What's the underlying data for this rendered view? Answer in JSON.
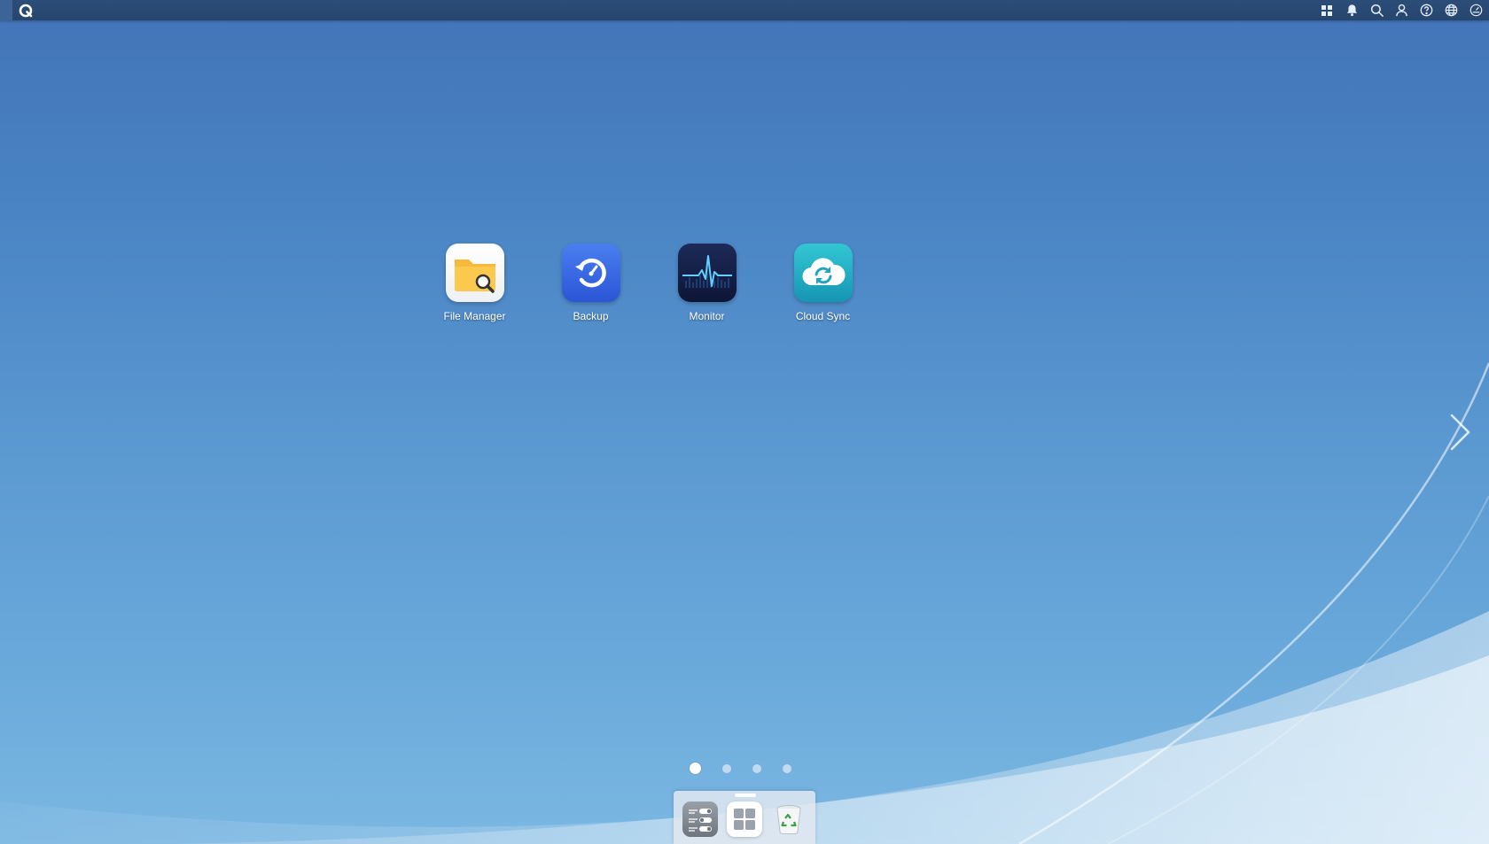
{
  "topbar": {
    "logo_icon": "qnap-q-logo-icon",
    "tray_icons": [
      "apps-grid-icon",
      "bell-icon",
      "search-icon",
      "user-icon",
      "help-icon",
      "globe-icon",
      "dashboard-gauge-icon"
    ]
  },
  "desktop": {
    "apps": [
      {
        "label": "File Manager",
        "icon": "folder-search-icon",
        "color": "#f6b93b"
      },
      {
        "label": "Backup",
        "icon": "backup-clock-icon",
        "color": "#2f5fe0"
      },
      {
        "label": "Monitor",
        "icon": "heartbeat-monitor-icon",
        "color": "#1a2550"
      },
      {
        "label": "Cloud Sync",
        "icon": "cloud-sync-icon",
        "color": "#1fb0c8"
      }
    ],
    "next_page_icon": "chevron-right-icon"
  },
  "pager": {
    "page_count": 4,
    "active_page": 1
  },
  "dock": {
    "items": [
      {
        "name": "control-panel",
        "icon": "toggle-settings-icon"
      },
      {
        "name": "main-menu",
        "icon": "grid-icon"
      },
      {
        "name": "recycle-bin",
        "icon": "recycle-bin-icon"
      }
    ]
  },
  "colors": {
    "topbar": "#26466f",
    "desktop_top": "#4274b8",
    "desktop_bottom": "#7bb7e2"
  }
}
